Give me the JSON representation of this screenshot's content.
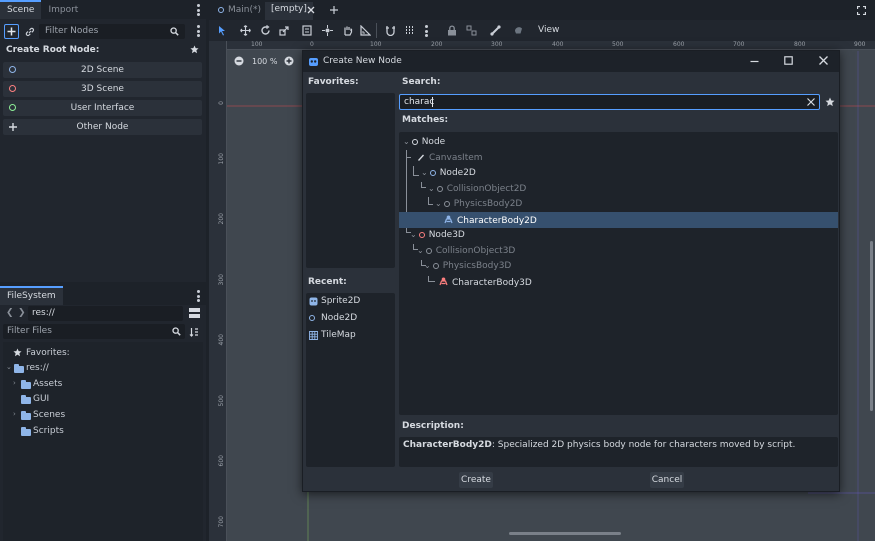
{
  "scene_dock": {
    "tabs": [
      "Scene",
      "Import"
    ],
    "filter_placeholder": "Filter Nodes",
    "create_root_label": "Create Root Node:",
    "root_buttons": [
      {
        "label": "2D Scene",
        "color": "#8fb5e8"
      },
      {
        "label": "3D Scene",
        "color": "#fc7f7f"
      },
      {
        "label": "User Interface",
        "color": "#8eef97"
      },
      {
        "label": "Other Node",
        "color": "#d6dae0"
      }
    ]
  },
  "filesystem": {
    "tab": "FileSystem",
    "path": "res://",
    "filter_placeholder": "Filter Files",
    "favorites_label": "Favorites:",
    "root": "res://",
    "folders": [
      "Assets",
      "GUI",
      "Scenes",
      "Scripts"
    ]
  },
  "editor": {
    "scene_tabs": [
      "Main(*)",
      "[empty]"
    ],
    "view_label": "View",
    "zoom": "100 %",
    "ruler_top": [
      "100",
      "0",
      "100",
      "200",
      "300",
      "400",
      "500",
      "600",
      "700",
      "800",
      "900"
    ],
    "ruler_left": [
      "0",
      "100",
      "200",
      "300",
      "400",
      "500",
      "600",
      "700"
    ]
  },
  "dialog": {
    "title": "Create New Node",
    "favorites_label": "Favorites:",
    "recent_label": "Recent:",
    "search_label": "Search:",
    "search_value": "charac",
    "matches_label": "Matches:",
    "description_label": "Description:",
    "description_name": "CharacterBody2D",
    "description_text": ": Specialized 2D physics body node for characters moved by script.",
    "recent": [
      "Sprite2D",
      "Node2D",
      "TileMap"
    ],
    "tree": [
      {
        "label": "Node",
        "dim": false,
        "color": "#d6dae0"
      },
      {
        "label": "CanvasItem",
        "dim": true,
        "color": "#d6dae0"
      },
      {
        "label": "Node2D",
        "dim": false,
        "color": "#8fb5e8"
      },
      {
        "label": "CollisionObject2D",
        "dim": true,
        "color": "#8fb5e8"
      },
      {
        "label": "PhysicsBody2D",
        "dim": true,
        "color": "#8fb5e8"
      },
      {
        "label": "CharacterBody2D",
        "dim": false,
        "color": "#8fb5e8"
      },
      {
        "label": "Node3D",
        "dim": false,
        "color": "#fc7f7f"
      },
      {
        "label": "CollisionObject3D",
        "dim": true,
        "color": "#fc7f7f"
      },
      {
        "label": "PhysicsBody3D",
        "dim": true,
        "color": "#fc7f7f"
      },
      {
        "label": "CharacterBody3D",
        "dim": false,
        "color": "#fc7f7f"
      }
    ],
    "create_button": "Create",
    "cancel_button": "Cancel"
  },
  "colors": {
    "accent": "#569eff",
    "selection": "#36506e",
    "node2d": "#8fb5e8",
    "node3d": "#fc7f7f",
    "control": "#8eef97"
  }
}
